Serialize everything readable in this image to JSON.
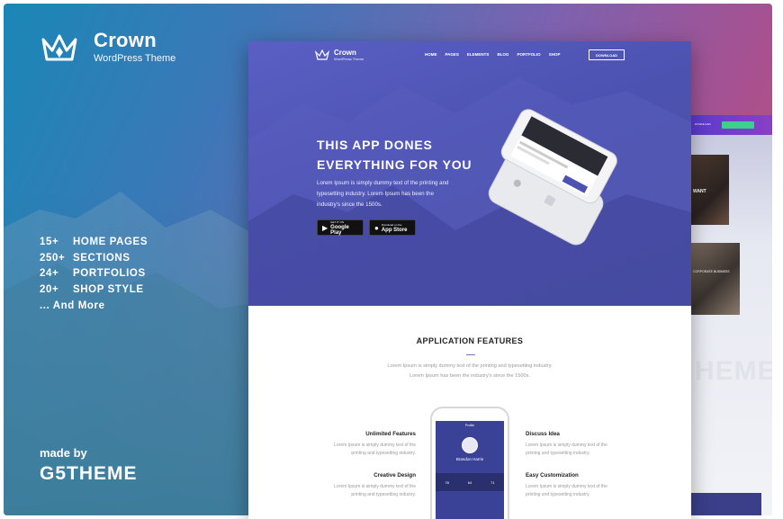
{
  "banner": {
    "brand_name": "Crown",
    "brand_sub": "WordPress Theme",
    "features": [
      {
        "num": "15+",
        "label": "HOME PAGES"
      },
      {
        "num": "250+",
        "label": "SECTIONS"
      },
      {
        "num": "24+",
        "label": "PORTFOLIOS"
      },
      {
        "num": "20+",
        "label": "SHOP STYLE"
      }
    ],
    "more": "... And More",
    "made_by": "made by",
    "maker": "G5THEME"
  },
  "mock": {
    "nav": {
      "logo_name": "Crown",
      "logo_sub": "WordPress Theme",
      "items": [
        "HOME",
        "PAGES",
        "ELEMENTS",
        "BLOG",
        "PORTFOLIO",
        "SHOP"
      ],
      "button": "DOWNLOAD"
    },
    "hero": {
      "title_line1": "THIS APP DONES",
      "title_line2": "EVERYTHING FOR YOU",
      "desc": "Lorem Ipsum is simply dummy text of the printing and typesetting industry. Lorem Ipsum has been the industry's since the 1500s.",
      "google_small": "GET IT ON",
      "google": "Google Play",
      "apple_small": "Download on the",
      "apple": "App Store"
    },
    "section": {
      "title": "APPLICATION FEATURES",
      "desc1": "Lorem Ipsum is simply dummy text of the printing and typesetting industry.",
      "desc2": "Lorem Ipsum has been the industry's since the 1500s."
    },
    "features": [
      {
        "title": "Unlimited Features",
        "text": "Lorem Ipsum is simply dummy text of the printing and typesetting industry."
      },
      {
        "title": "Creative Design",
        "text": "Lorem Ipsum is simply dummy text of the printing and typesetting industry."
      },
      {
        "title": "Discuss Idea",
        "text": "Lorem Ipsum is simply dummy text of the printing and typesetting industry."
      },
      {
        "title": "Easy Customization",
        "text": "Lorem Ipsum is simply dummy text of the printing and typesetting industry."
      }
    ],
    "app": {
      "top": "Profile",
      "name": "Brandon Harris",
      "stats": [
        "78",
        "64",
        "71"
      ]
    }
  },
  "bg_page": {
    "big_text": "HEME",
    "photo1_text": "WANT",
    "photo2_text": "CORPORATE BUSINESS"
  },
  "colors": {
    "hero": "#4c52b0",
    "accent": "#6d74cf",
    "green": "#3ecf8e"
  }
}
